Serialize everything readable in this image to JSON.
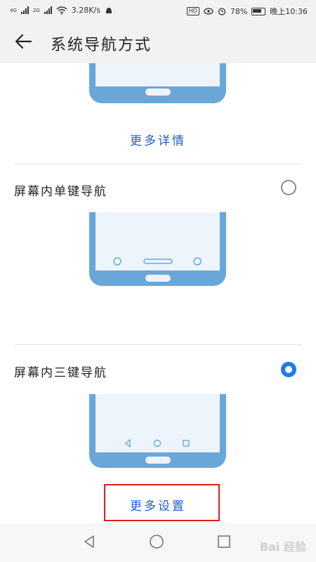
{
  "status_bar": {
    "net_speed": "3.28K/s",
    "sim1_type": "4G",
    "sim2_type": "2G",
    "battery_text": "78%",
    "time": "晚上10:36",
    "hd_label": "HD"
  },
  "app_bar": {
    "title": "系统导航方式"
  },
  "gesture_section": {
    "more_details_label": "更多详情"
  },
  "options": [
    {
      "label": "屏幕内单键导航",
      "selected": false
    },
    {
      "label": "屏幕内三键导航",
      "selected": true
    }
  ],
  "three_key_section": {
    "more_settings_label": "更多设置"
  },
  "watermark": {
    "text": "Bai 经验"
  },
  "colors": {
    "accent": "#1e7ce8",
    "link": "#1f5fc9",
    "phone_frame": "#6aa7d8",
    "highlight_box": "#d82020"
  }
}
